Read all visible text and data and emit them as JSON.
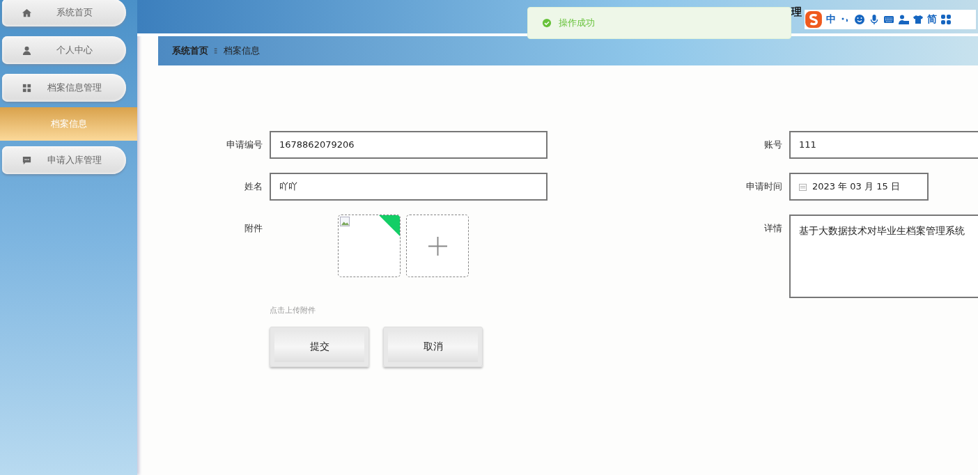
{
  "sidebar": {
    "items": [
      {
        "label": "系统首页",
        "selected": false
      },
      {
        "label": "个人中心",
        "selected": false
      },
      {
        "label": "档案信息管理",
        "selected": false,
        "children": [
          {
            "label": "档案信息",
            "selected": true
          }
        ]
      },
      {
        "label": "申请入库管理",
        "selected": false
      }
    ]
  },
  "header": {
    "title": "理"
  },
  "toast": {
    "message": "操作成功"
  },
  "ime_toolbar": {
    "items": [
      "中",
      "简"
    ]
  },
  "breadcrumb": [
    "系统首页",
    "档案信息"
  ],
  "form": {
    "left": [
      {
        "label": "申请编号",
        "kind": "text",
        "value": "1678862079206"
      },
      {
        "label": "姓名",
        "kind": "text",
        "value": "吖吖"
      },
      {
        "label": "附件",
        "kind": "upload",
        "hint": "点击上传附件"
      }
    ],
    "right": [
      {
        "label": "账号",
        "kind": "text",
        "value": "111"
      },
      {
        "label": "申请时间",
        "kind": "date",
        "value": "2023 年 03 月 15 日"
      },
      {
        "label": "详情",
        "kind": "textarea",
        "value": "基于大数据技术对毕业生档案管理系统"
      }
    ],
    "buttons": [
      "提交",
      "取消"
    ]
  }
}
